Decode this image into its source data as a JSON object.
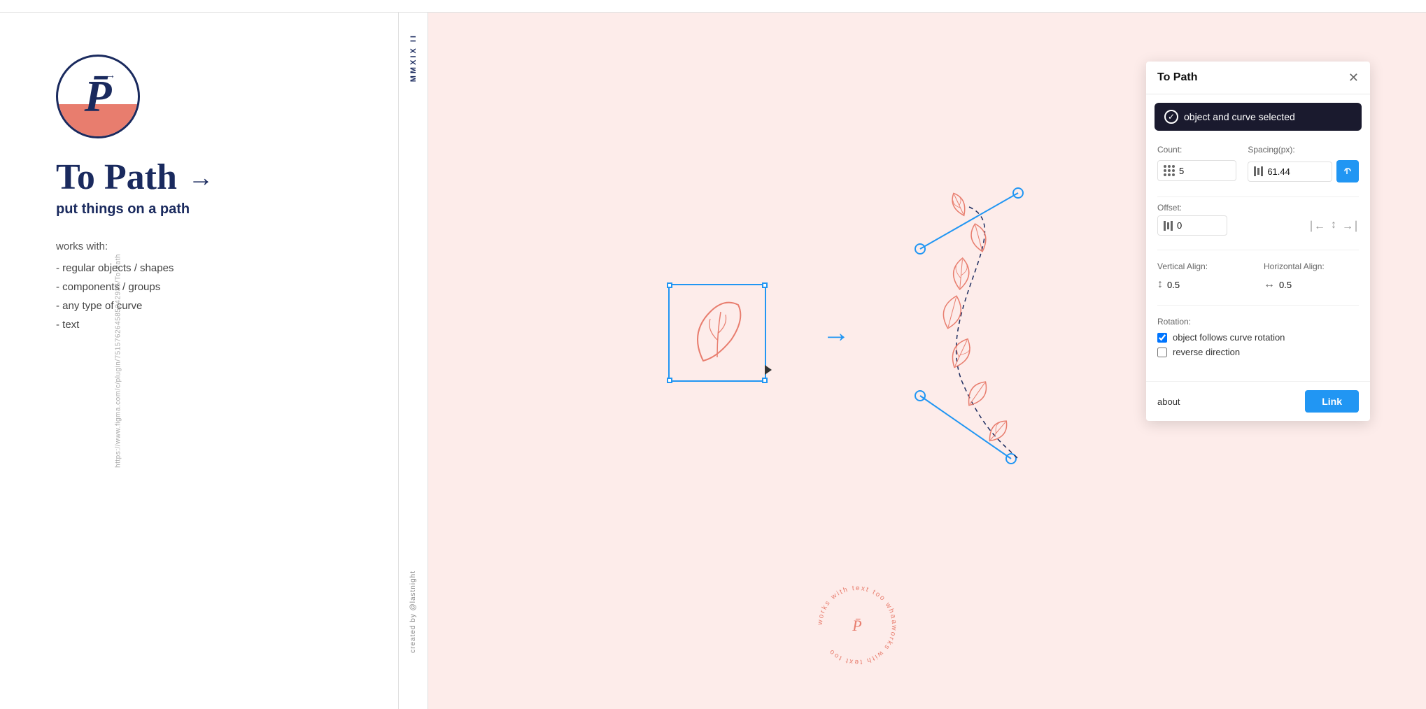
{
  "topbar": {
    "height": 18
  },
  "leftpanel": {
    "url": "https://www.figma.com/c/plugin/751576264585242935/To-Path",
    "logo": {
      "letter": "P",
      "arrow": "→"
    },
    "title": "To Path",
    "title_arrow": "→",
    "subtitle": "put things on a path",
    "works_with_title": "works with:",
    "works_with_items": [
      "- regular objects / shapes",
      "- components / groups",
      "- any type of curve",
      "- text"
    ]
  },
  "divider": {
    "top_text": "MMXIX II",
    "bottom_text": "created by @lastnight"
  },
  "plugin": {
    "title": "To Path",
    "close_label": "✕",
    "status": {
      "text": "object and curve selected",
      "icon": "✓"
    },
    "count": {
      "label": "Count:",
      "value": "5"
    },
    "spacing": {
      "label": "Spacing(px):",
      "value": "61.44"
    },
    "offset": {
      "label": "Offset:",
      "value": "0"
    },
    "vertical_align": {
      "label": "Vertical Align:",
      "value": "0.5"
    },
    "horizontal_align": {
      "label": "Horizontal Align:",
      "value": "0.5"
    },
    "rotation": {
      "label": "Rotation:",
      "follows_curve": "object follows curve rotation",
      "reverse": "reverse direction"
    },
    "about_label": "about",
    "link_label": "Link"
  }
}
